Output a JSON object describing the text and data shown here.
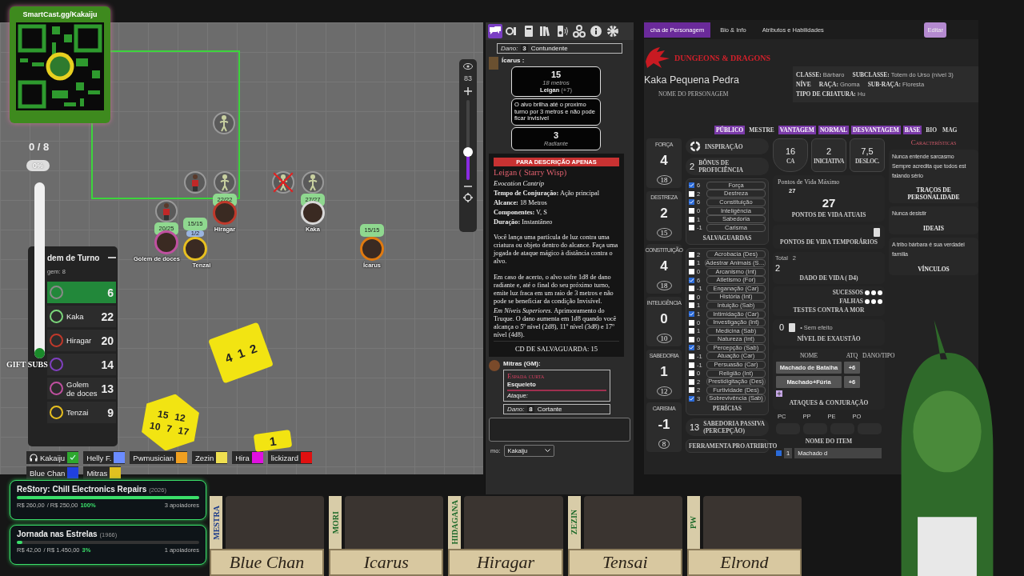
{
  "qr_card": {
    "url": "SmartCast.gg/Kakaiju"
  },
  "subs_meter": {
    "count": "0 / 8",
    "percent": "0%",
    "label": "GIFT SUBS",
    "level": 0
  },
  "map": {
    "zoom": {
      "value": "83",
      "level": 0.35
    },
    "tokens": [
      {
        "kind": "skeleton",
        "defeated": false
      },
      {
        "kind": "figure",
        "defeated": false
      },
      {
        "kind": "skeleton",
        "defeated": false,
        "bars": [
          {
            "kind": "hp",
            "text": "22/22"
          }
        ]
      },
      {
        "kind": "skeleton",
        "defeated": true
      },
      {
        "kind": "skeleton",
        "defeated": false,
        "bars": [
          {
            "kind": "hp",
            "text": "27/27"
          }
        ]
      },
      {
        "kind": "figure",
        "defeated": false,
        "bars": [
          {
            "kind": "hp",
            "text": "20/25"
          }
        ]
      },
      {
        "kind": "portrait",
        "name": "Hiragar",
        "color": "#c0392b",
        "defeated": false
      },
      {
        "kind": "portrait",
        "name": "Kaka",
        "color": "#d8d8d8",
        "defeated": false
      },
      {
        "kind": "portrait",
        "name": "Golem de doces",
        "color": "#c050a0",
        "defeated": false
      },
      {
        "kind": "portrait",
        "name": "Tenzai",
        "color": "#e8c020",
        "defeated": false,
        "bars": [
          {
            "kind": "hp",
            "text": "15/15"
          },
          {
            "kind": "resource",
            "text": "1/2"
          }
        ]
      },
      {
        "kind": "portrait",
        "name": "Ícarus",
        "color": "#e07a10",
        "defeated": false,
        "bars": [
          {
            "kind": "hp",
            "text": "15/15"
          }
        ]
      }
    ],
    "dice": [
      {
        "kind": "d6",
        "faces": [
          "4",
          "1",
          "2"
        ]
      },
      {
        "kind": "d20",
        "faces": [
          "15",
          "12",
          "10",
          "7",
          "17"
        ]
      },
      {
        "kind": "d6",
        "faces": [
          "1"
        ]
      }
    ]
  },
  "turn_order": {
    "title": "dem de Turno",
    "count": "gem: 8",
    "entries": [
      {
        "initiative": "6",
        "selected": true,
        "color": "#8a8a8a"
      },
      {
        "name": "Kaka",
        "initiative": "22",
        "selected": false,
        "color": "#7bd67b"
      },
      {
        "name": "Hiragar",
        "initiative": "20",
        "selected": false,
        "color": "#c0392b"
      },
      {
        "initiative": "14",
        "selected": false,
        "color": "#8040c0"
      },
      {
        "name": "Golem de doces",
        "initiative": "13",
        "selected": false,
        "color": "#c050a0"
      },
      {
        "name": "Tenzai",
        "initiative": "9",
        "selected": false,
        "color": "#e8c020"
      }
    ]
  },
  "players": [
    {
      "kind": "self",
      "name": "Kakaiju",
      "color": "#2ea82e"
    },
    {
      "kind": "player",
      "name": "Helly F.",
      "color": "#6b8cff"
    },
    {
      "kind": "player",
      "name": "Pwmusician",
      "color": "#f0a020"
    },
    {
      "kind": "player",
      "name": "Zezin",
      "color": "#f0e050"
    },
    {
      "kind": "player",
      "name": "Hira",
      "color": "#e010e0"
    },
    {
      "kind": "player",
      "name": "lickizard",
      "color": "#e01010"
    },
    {
      "kind": "player",
      "name": "Blue Chan",
      "color": "#2040e0"
    },
    {
      "kind": "player",
      "name": "Mitras",
      "color": "#e0c020"
    }
  ],
  "goals": [
    {
      "title": "ReStory: Chill Electronics Repairs",
      "year": "(2026)",
      "raised": "R$ 260,00",
      "target": "/ R$ 250,00",
      "percent": "100%",
      "supporters": "3 apoiadores",
      "level": 1
    },
    {
      "title": "Jornada nas Estrelas",
      "year": "(1966)",
      "raised": "R$ 42,00",
      "target": "/ R$ 1.450,00",
      "percent": "3%",
      "supporters": "1 apoiadores",
      "level": 0.03
    }
  ],
  "chat": {
    "tabs": [
      {
        "kind": "chat",
        "selected": true
      },
      {
        "kind": "dice",
        "selected": false
      },
      {
        "kind": "journal",
        "selected": false
      },
      {
        "kind": "library",
        "selected": false
      },
      {
        "kind": "jukebox",
        "selected": false
      },
      {
        "kind": "nodes",
        "selected": false
      },
      {
        "kind": "info",
        "selected": false
      },
      {
        "kind": "settings",
        "selected": false
      }
    ],
    "previous_damage": {
      "label": "Dano:",
      "value": "3",
      "type": "Contundente"
    },
    "roll": {
      "speaker": "Ícarus :",
      "result": "15",
      "range": "18 metros",
      "spell": "Leigan",
      "bonus": "(+7)",
      "description": "O alvo brilha até o proximo turno por 3 metros e não pode ficar invisível",
      "damage": "3",
      "damage_type": "Radiante"
    },
    "spell": {
      "banner": "PARA DESCRIÇÃO APENAS",
      "title": "Leigan ( Starry Wisp)",
      "subtitle": "Evocation Cantrip",
      "properties": [
        "**Tempo de Conjuração:** Ação principal",
        "**Alcance:** 18 Metros",
        "**Componentes:** V, S",
        "**Duração:** Instantâneo"
      ],
      "paragraphs": [
        "Você lança uma partícula de luz contra uma criatura ou objeto dentro do alcance. Faça uma jogada de ataque mágico à distância contra o alvo.",
        "Em caso de acerto, o alvo sofre 1d8 de dano radiante e, até o final do seu próximo turno, emite luz fraca em um raio de 3 metros e não pode se beneficiar da condição Invisível.",
        "*Em Níveis Superiores*. Aprimoramento do Truque. O dano aumenta em 1d8 quando você alcança o 5º nível (2d8), 11º nível (3d8) e 17º nível (4d8)."
      ],
      "save": "CD DE SALVAGUARDA: 15"
    },
    "gm_message": {
      "speaker": "Mitras (GM):",
      "weapon": "Espada curta",
      "source": "Esqueleto",
      "attack_label": "Ataque:",
      "damage_label": "Dano:",
      "damage": "8",
      "damage_type": "Cortante"
    },
    "speak_as": {
      "label": "mo:",
      "value": "Kakaiju"
    }
  },
  "sheet": {
    "tabs": [
      {
        "label": "cha de Personagem",
        "selected": true
      },
      {
        "label": "Bio & Info",
        "selected": false
      },
      {
        "label": "Atributos e Habilidades",
        "selected": false
      }
    ],
    "edit_button": "Editar",
    "logo": "DUNGEONS & DRAGONS",
    "character_name": "Kaka Pequena Pedra",
    "name_label": "NOME DO PERSONAGEM",
    "info": [
      {
        "label": "CLASSE:",
        "value": "Bárbaro"
      },
      {
        "label": "SUBCLASSE:",
        "value": "Totem do Urso (nível 3)"
      },
      {
        "label": "NÍVE"
      },
      {
        "label": "RAÇA:",
        "value": "Gnoma"
      },
      {
        "label": "SUB-RAÇA:",
        "value": "Floresta"
      },
      {
        "label": "TIPO DE CRIATURA:",
        "value": "Hu"
      }
    ],
    "toggles": [
      {
        "label": "PÚBLICO",
        "selected": true
      },
      {
        "label": "MESTRE",
        "selected": false
      },
      {
        "label": "VANTAGEM",
        "selected": true
      },
      {
        "label": "NORMAL",
        "selected": true
      },
      {
        "label": "DESVANTAGEM",
        "selected": true
      },
      {
        "label": "BASE",
        "selected": true
      },
      {
        "label": "BIO",
        "selected": false
      },
      {
        "label": "MAG",
        "selected": false
      }
    ],
    "abilities": [
      {
        "name": "FORÇA",
        "modifier": "4",
        "score": "18"
      },
      {
        "name": "DESTREZA",
        "modifier": "2",
        "score": "15"
      },
      {
        "name": "CONSTITUIÇÃO",
        "modifier": "4",
        "score": "18"
      },
      {
        "name": "INTELIGÊNCIA",
        "modifier": "0",
        "score": "10"
      },
      {
        "name": "SABEDORIA",
        "modifier": "1",
        "score": "12"
      },
      {
        "name": "CARISMA",
        "modifier": "-1",
        "score": "8"
      }
    ],
    "inspiration": "INSPIRAÇÃO",
    "proficiency": {
      "value": "2",
      "label": "BÔNUS DE PROFICIÊNCIA"
    },
    "saves": {
      "title": "SALVAGUARDAS",
      "items": [
        {
          "value": "6",
          "name": "Força",
          "checked": true
        },
        {
          "value": "2",
          "name": "Destreza",
          "checked": false
        },
        {
          "value": "6",
          "name": "Constituição",
          "checked": true
        },
        {
          "value": "0",
          "name": "Inteligência",
          "checked": false
        },
        {
          "value": "1",
          "name": "Sabedoria",
          "checked": false
        },
        {
          "value": "-1",
          "name": "Carisma",
          "checked": false
        }
      ]
    },
    "skills": {
      "title": "PERÍCIAS",
      "items": [
        {
          "value": "2",
          "name": "Acrobacia (Des)",
          "checked": false
        },
        {
          "value": "1",
          "name": "Adestrar Animais (S…",
          "checked": false
        },
        {
          "value": "0",
          "name": "Arcanismo (Int)",
          "checked": false
        },
        {
          "value": "6",
          "name": "Atletismo (For)",
          "checked": true
        },
        {
          "value": "-1",
          "name": "Enganação (Car)",
          "checked": false
        },
        {
          "value": "0",
          "name": "História (Int)",
          "checked": false
        },
        {
          "value": "1",
          "name": "Intuição (Sab)",
          "checked": false
        },
        {
          "value": "1",
          "name": "Intimidação (Car)",
          "checked": true
        },
        {
          "value": "0",
          "name": "Investigação (Int)",
          "checked": false
        },
        {
          "value": "1",
          "name": "Medicina (Sab)",
          "checked": false
        },
        {
          "value": "0",
          "name": "Natureza (Int)",
          "checked": false
        },
        {
          "value": "3",
          "name": "Percepção (Sab)",
          "checked": true
        },
        {
          "value": "-1",
          "name": "Atuação (Car)",
          "checked": false
        },
        {
          "value": "-1",
          "name": "Persuasão (Car)",
          "checked": false
        },
        {
          "value": "0",
          "name": "Religião (Int)",
          "checked": false
        },
        {
          "value": "2",
          "name": "Prestidigitação (Des)",
          "checked": false
        },
        {
          "value": "2",
          "name": "Furtividade (Des)",
          "checked": false
        },
        {
          "value": "3",
          "name": "Sobrevivência (Sab)",
          "checked": true
        }
      ]
    },
    "passive": {
      "value": "13",
      "label": "SABEDORIA PASSIVA (PERCEPÇÃO)"
    },
    "tools": {
      "columns": [
        "FERRAMENTA",
        "PRO",
        "ATRIBUTO"
      ]
    },
    "combat": [
      {
        "kind": "shield",
        "value": "16",
        "label": "CA"
      },
      {
        "kind": "box",
        "value": "2",
        "label": "INICIATIVA"
      },
      {
        "kind": "box",
        "value": "7,5",
        "label": "DESLOC."
      }
    ],
    "hp": {
      "max_label": "Pontos de Vida Máximo",
      "max": "27",
      "current": "27",
      "current_label": "PONTOS DE VIDA ATUAIS",
      "temp_label": "PONTOS DE VIDA TEMPORÁRIOS"
    },
    "hit_dice": {
      "total_label": "Total",
      "total": "2",
      "value": "2",
      "label": "DADO DE VIDA",
      "die": "( D4)"
    },
    "death_saves": {
      "successes_label": "SUCESSOS",
      "failures_label": "FALHAS",
      "title": "TESTES CONTRA A MOR",
      "successes": [
        false,
        false,
        false
      ],
      "failures": [
        false,
        false,
        false
      ]
    },
    "exhaustion": {
      "value": "0",
      "note": "• Sem efeito",
      "label": "NÍVEL DE EXAUSTÃO"
    },
    "attacks": {
      "columns": [
        "NOME",
        "ATQ",
        "DANO/TIPO"
      ],
      "rows": [
        {
          "name": "Machado de Batalha",
          "bonus": "+6"
        },
        {
          "name": "Machado+Fúria",
          "bonus": "+6"
        }
      ],
      "title": "ATAQUES & CONJURAÇÃO"
    },
    "coins": [
      "PC",
      "PP",
      "PE",
      "PO"
    ],
    "inventory": {
      "column": "NOME DO ITEM",
      "rows": [
        {
          "checked": true,
          "quantity": "1",
          "name": "Machado d"
        }
      ]
    },
    "characteristics": {
      "title": "Características",
      "boxes": [
        {
          "lines": [
            "Nunca entende sarcasmo",
            "Sempre acredita que todos est",
            "falando sério"
          ],
          "label": "TRAÇOS DE PERSONALIDADE"
        },
        {
          "lines": [
            "Nunca desistir"
          ],
          "label": "IDEAIS"
        },
        {
          "lines": [
            "A tribo bárbara é sua verdadei",
            "família"
          ],
          "label": "VÍNCULOS"
        }
      ]
    }
  },
  "banners": [
    {
      "tag": "MESTRA",
      "name": "Blue Chan",
      "color": "#1a3a8a"
    },
    {
      "tag": "MORI",
      "name": "Icarus",
      "color": "#1e6a2a"
    },
    {
      "tag": "HIDAGANA",
      "name": "Hiragar",
      "color": "#1e6a2a"
    },
    {
      "tag": "ZEZIN",
      "name": "Tensai",
      "color": "#1e6a2a"
    },
    {
      "tag": "PW",
      "name": "Elrond",
      "color": "#1e6a2a"
    }
  ]
}
